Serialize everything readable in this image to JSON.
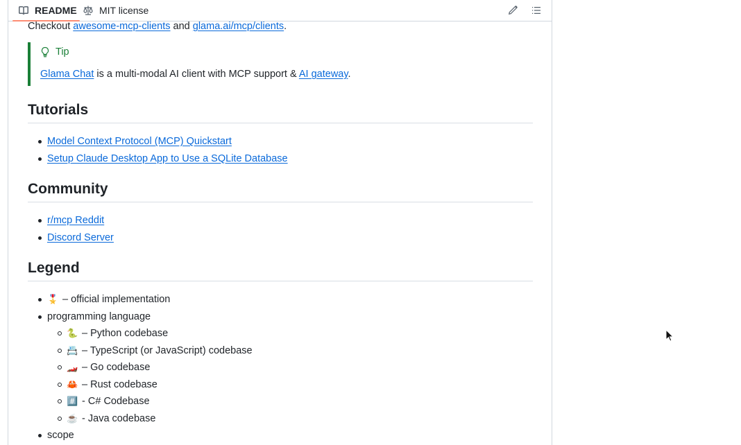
{
  "tabs": [
    {
      "label": "README",
      "icon": "book-icon",
      "active": true
    },
    {
      "label": "MIT license",
      "icon": "scale-icon",
      "active": false
    }
  ],
  "toolbar": {
    "edit_icon": "pencil-icon",
    "outline_icon": "list-icon"
  },
  "intro": {
    "prefix": "Checkout ",
    "link1": "awesome-mcp-clients",
    "middle": " and ",
    "link2": "glama.ai/mcp/clients",
    "suffix": "."
  },
  "tip": {
    "title": "Tip",
    "link1": "Glama Chat",
    "middle": " is a multi-modal AI client with MCP support & ",
    "link2": "AI gateway",
    "suffix": "."
  },
  "tutorials": {
    "heading": "Tutorials",
    "items": [
      "Model Context Protocol (MCP) Quickstart",
      "Setup Claude Desktop App to Use a SQLite Database"
    ]
  },
  "community": {
    "heading": "Community",
    "items": [
      "r/mcp Reddit",
      "Discord Server"
    ]
  },
  "legend": {
    "heading": "Legend",
    "official": {
      "emoji": "🎖️",
      "text": " – official implementation"
    },
    "language_label": "programming language",
    "languages": [
      {
        "emoji": "🐍",
        "text": " – Python codebase"
      },
      {
        "emoji": "📇",
        "text": " – TypeScript (or JavaScript) codebase"
      },
      {
        "emoji": "🏎️",
        "text": " – Go codebase"
      },
      {
        "emoji": "🦀",
        "text": " – Rust codebase"
      },
      {
        "emoji": "#️⃣",
        "text": " - C# Codebase"
      },
      {
        "emoji": "☕",
        "text": " - Java codebase"
      }
    ],
    "scope_label": "scope"
  },
  "colors": {
    "link": "#0969da",
    "tip_accent": "#1a7f37",
    "tab_underline": "#fd8c73"
  }
}
